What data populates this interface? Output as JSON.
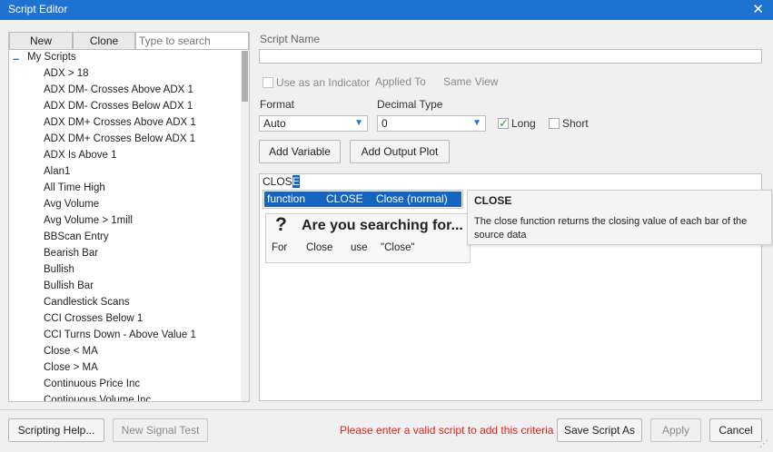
{
  "window": {
    "title": "Script Editor"
  },
  "left": {
    "new_label": "New",
    "clone_label": "Clone",
    "search_placeholder": "Type to search",
    "tree_root": "My Scripts",
    "scripts": [
      "ADX > 18",
      "ADX DM- Crosses Above ADX 1",
      "ADX DM- Crosses Below ADX 1",
      "ADX DM+ Crosses Above ADX 1",
      "ADX DM+ Crosses Below ADX 1",
      "ADX Is Above 1",
      "Alan1",
      "All Time High",
      "Avg Volume",
      "Avg Volume > 1mill",
      "BBScan Entry",
      "Bearish Bar",
      "Bullish",
      "Bullish Bar",
      "Candlestick Scans",
      "CCI Crosses Below 1",
      "CCI Turns Down - Above Value 1",
      "Close < MA",
      "Close > MA",
      "Continuous Price Inc",
      "Continuous Volume Inc"
    ]
  },
  "form": {
    "script_name_label": "Script Name",
    "script_name_value": "",
    "use_indicator_label": "Use as an Indicator",
    "applied_to_label": "Applied To",
    "applied_to_value": "Same View",
    "format_label": "Format",
    "format_value": "Auto",
    "decimal_label": "Decimal Type",
    "decimal_value": "0",
    "long_label": "Long",
    "long_checked": true,
    "short_label": "Short",
    "short_checked": false,
    "add_variable_label": "Add Variable",
    "add_output_label": "Add Output Plot"
  },
  "editor": {
    "text_before_cursor": "CLOS",
    "text_selected": "E"
  },
  "autocomplete": {
    "kind": "function",
    "name": "CLOSE",
    "detail": "Close (normal)"
  },
  "searching": {
    "title": "Are you searching for...",
    "words": [
      "For",
      "Close",
      "use",
      "\"Close\""
    ]
  },
  "tooltip": {
    "title": "CLOSE",
    "body": "The close function returns the closing value of each bar of the source data"
  },
  "footer": {
    "scripting_help": "Scripting Help...",
    "new_signal_test": "New Signal Test",
    "error": "Please enter a valid script to add this criteria",
    "save_as": "Save Script As",
    "apply": "Apply",
    "cancel": "Cancel"
  },
  "colors": {
    "titlebar": "#1e73d2",
    "selection": "#1565c0",
    "error": "#e0211b",
    "check": "#2e9e3b"
  }
}
